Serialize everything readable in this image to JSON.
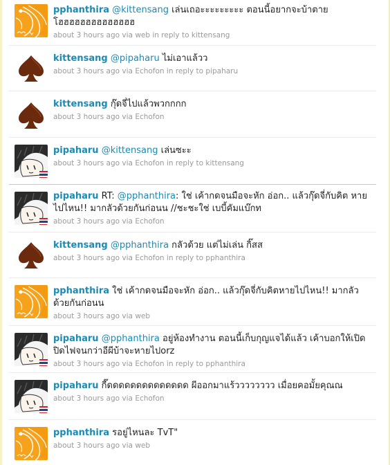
{
  "tweets": [
    {
      "user": "pphanthira",
      "mention": "@kittensang",
      "text": " เล่นเถอะะะะะะะะะ ตอนนี้อยากจะบ้าตาย โฮฮฮฮฮฮฮฮฮฮฮฮฮฮ",
      "time": "about 3 hours ago",
      "via": "via",
      "source": "web",
      "reply_prefix": "in reply to",
      "reply_to": "kittensang",
      "avatar": "pphanthira-avatar"
    },
    {
      "user": "kittensang",
      "mention": "@pipaharu",
      "text": " ไม่เอาแล้วว",
      "time": "about 3 hours ago",
      "via": "via",
      "source": "Echofon",
      "reply_prefix": "in reply to",
      "reply_to": "pipaharu",
      "avatar": "spade-avatar"
    },
    {
      "user": "kittensang",
      "mention": "",
      "text": " กุ๊ดจี่ไปแล้วพวกกกก",
      "time": "about 3 hours ago",
      "via": "via",
      "source": "Echofon",
      "reply_prefix": "",
      "reply_to": "",
      "avatar": "spade-avatar"
    },
    {
      "user": "pipaharu",
      "mention": "@kittensang",
      "text": " เล่นซะะ",
      "time": "about 3 hours ago",
      "via": "via",
      "source": "Echofon",
      "reply_prefix": "in reply to",
      "reply_to": "kittensang",
      "avatar": "pipaharu-avatar"
    },
    {
      "user": "pipaharu",
      "prefix": " RT: ",
      "mention": "@pphanthira",
      "text": ": ใช่ เค้ากดจนมือจะหัก อ่อก.. แล้วกุ๊ดจี่กับคิต หายไปไหน!! มากลัวด้วยกันก่อนน //ชะชะใช่ เบบี้คัมแบ๊กท",
      "time": "about 3 hours ago",
      "via": "via",
      "source": "Echofon",
      "reply_prefix": "",
      "reply_to": "",
      "avatar": "pipaharu-avatar"
    },
    {
      "user": "kittensang",
      "mention": "@pphanthira",
      "text": " กลัวด้วย แต่ไม่เล่น กิ๊สส",
      "time": "about 3 hours ago",
      "via": "via",
      "source": "Echofon",
      "reply_prefix": "in reply to",
      "reply_to": "pphanthira",
      "avatar": "spade-avatar"
    },
    {
      "user": "pphanthira",
      "mention": "",
      "text": " ใช่ เค้ากดจนมือจะหัก อ่อก.. แล้วกุ๊ดจี่กับคิตหายไปไหน!! มากลัวด้วยกันก่อนน",
      "time": "about 3 hours ago",
      "via": "via",
      "source": "web",
      "reply_prefix": "",
      "reply_to": "",
      "avatar": "pphanthira-avatar"
    },
    {
      "user": "pipaharu",
      "mention": "@pphanthira",
      "text": " อยู่ห้องทำงาน ตอนนี้เก็บกุญแจได้แล้ว เค้าบอกให้เปิดปิดไฟจนกว่าอีผีบ้าจะหายไปorz",
      "time": "about 3 hours ago",
      "via": "via",
      "source": "Echofon",
      "reply_prefix": "in reply to",
      "reply_to": "pphanthira",
      "avatar": "pipaharu-avatar"
    },
    {
      "user": "pipaharu",
      "mention": "",
      "text": " กี๊ดดดดดดดดดดดดดด ผีออกมาแร้วววววววว เมื่อยคอมั้ยคุณณ",
      "time": "about 3 hours ago",
      "via": "via",
      "source": "Echofon",
      "reply_prefix": "",
      "reply_to": "",
      "avatar": "pipaharu-avatar"
    },
    {
      "user": "pphanthira",
      "mention": "",
      "text": " รอยู่ไหนละ TvT\"",
      "time": "about 3 hours ago",
      "via": "via",
      "source": "web",
      "reply_prefix": "",
      "reply_to": "",
      "avatar": "pphanthira-avatar"
    }
  ],
  "colors": {
    "link": "#1a8bb5",
    "meta": "#999999",
    "text": "#222222",
    "spade": "#6b2a0e",
    "orange_avatar": "#f7a21c"
  }
}
